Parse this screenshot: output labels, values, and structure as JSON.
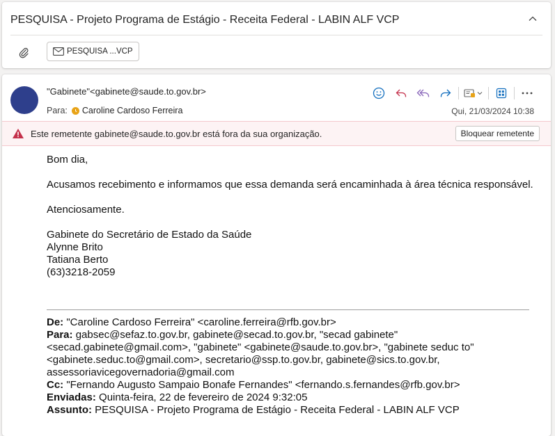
{
  "subject": "PESQUISA - Projeto Programa de Estágio - Receita Federal - LABIN ALF VCP",
  "attachment": {
    "label": "PESQUISA ...VCP"
  },
  "message": {
    "sender": "\"Gabinete\"<gabinete@saude.to.gov.br>",
    "to_label": "Para:",
    "recipient": "Caroline Cardoso Ferreira",
    "date": "Qui, 21/03/2024 10:38",
    "warning_text": "Este remetente gabinete@saude.to.gov.br está fora da sua organização.",
    "block_button": "Bloquear remetente"
  },
  "toolbar_icons": [
    "emoji-icon",
    "reply-icon",
    "reply-all-icon",
    "forward-icon",
    "apps-dropdown-icon",
    "grid-icon",
    "more-icon"
  ],
  "body": {
    "greeting": "Bom dia,",
    "paragraph": "Acusamos recebimento e informamos que essa demanda será encaminhada à área técnica responsável.",
    "closing": "Atenciosamente.",
    "signature": [
      "Gabinete do Secretário de Estado da Saúde",
      "Alynne Brito",
      "Tatiana Berto",
      "(63)3218-2059"
    ]
  },
  "quoted": {
    "from_label": "De:",
    "from": "\"Caroline Cardoso Ferreira\" <caroline.ferreira@rfb.gov.br>",
    "to_label": "Para:",
    "to": "gabsec@sefaz.to.gov.br, gabinete@secad.to.gov.br, \"secad gabinete\" <secad.gabinete@gmail.com>, \"gabinete\" <gabinete@saude.to.gov.br>, \"gabinete seduc to\" <gabinete.seduc.to@gmail.com>, secretario@ssp.to.gov.br, gabinete@sics.to.gov.br, assessoriavicegovernadoria@gmail.com",
    "cc_label": "Cc:",
    "cc": "\"Fernando Augusto Sampaio Bonafe Fernandes\" <fernando.s.fernandes@rfb.gov.br>",
    "sent_label": "Enviadas:",
    "sent": "Quinta-feira, 22 de fevereiro de 2024 9:32:05",
    "subject_label": "Assunto:",
    "subject": "PESQUISA - Projeto Programa de Estágio - Receita Federal - LABIN ALF VCP"
  }
}
